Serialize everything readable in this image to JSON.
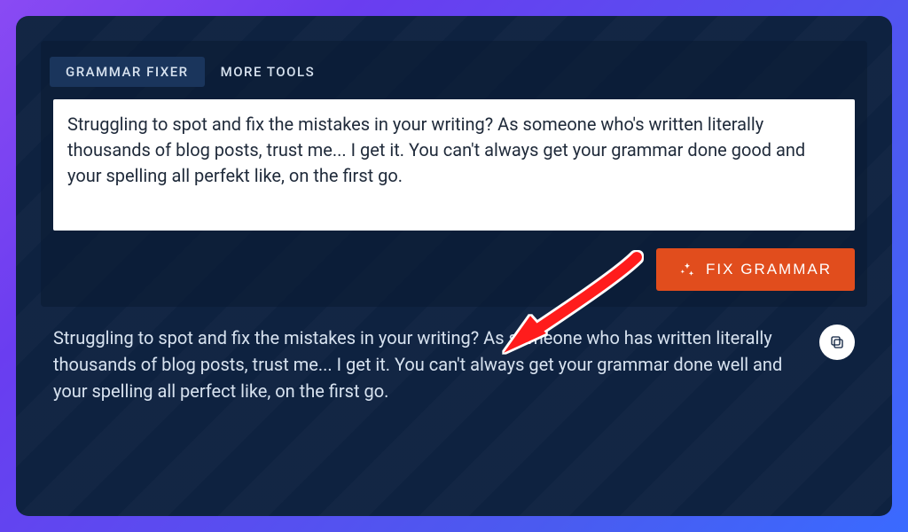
{
  "tabs": {
    "grammar_fixer": "GRAMMAR FIXER",
    "more_tools": "MORE TOOLS"
  },
  "input": {
    "value": "Struggling to spot and fix the mistakes in your writing? As someone who's written literally thousands of blog posts, trust me... I get it. You can't always get your grammar done good and your spelling all perfekt like, on the first go."
  },
  "actions": {
    "fix_grammar": "FIX GRAMMAR"
  },
  "output": {
    "text": "Struggling to spot and fix the mistakes in your writing? As someone who has written literally thousands of blog posts, trust me... I get it. You can't always get your grammar done well and your spelling all perfect like, on the first go."
  },
  "colors": {
    "accent": "#e14d1d",
    "panel": "#0e2240"
  }
}
